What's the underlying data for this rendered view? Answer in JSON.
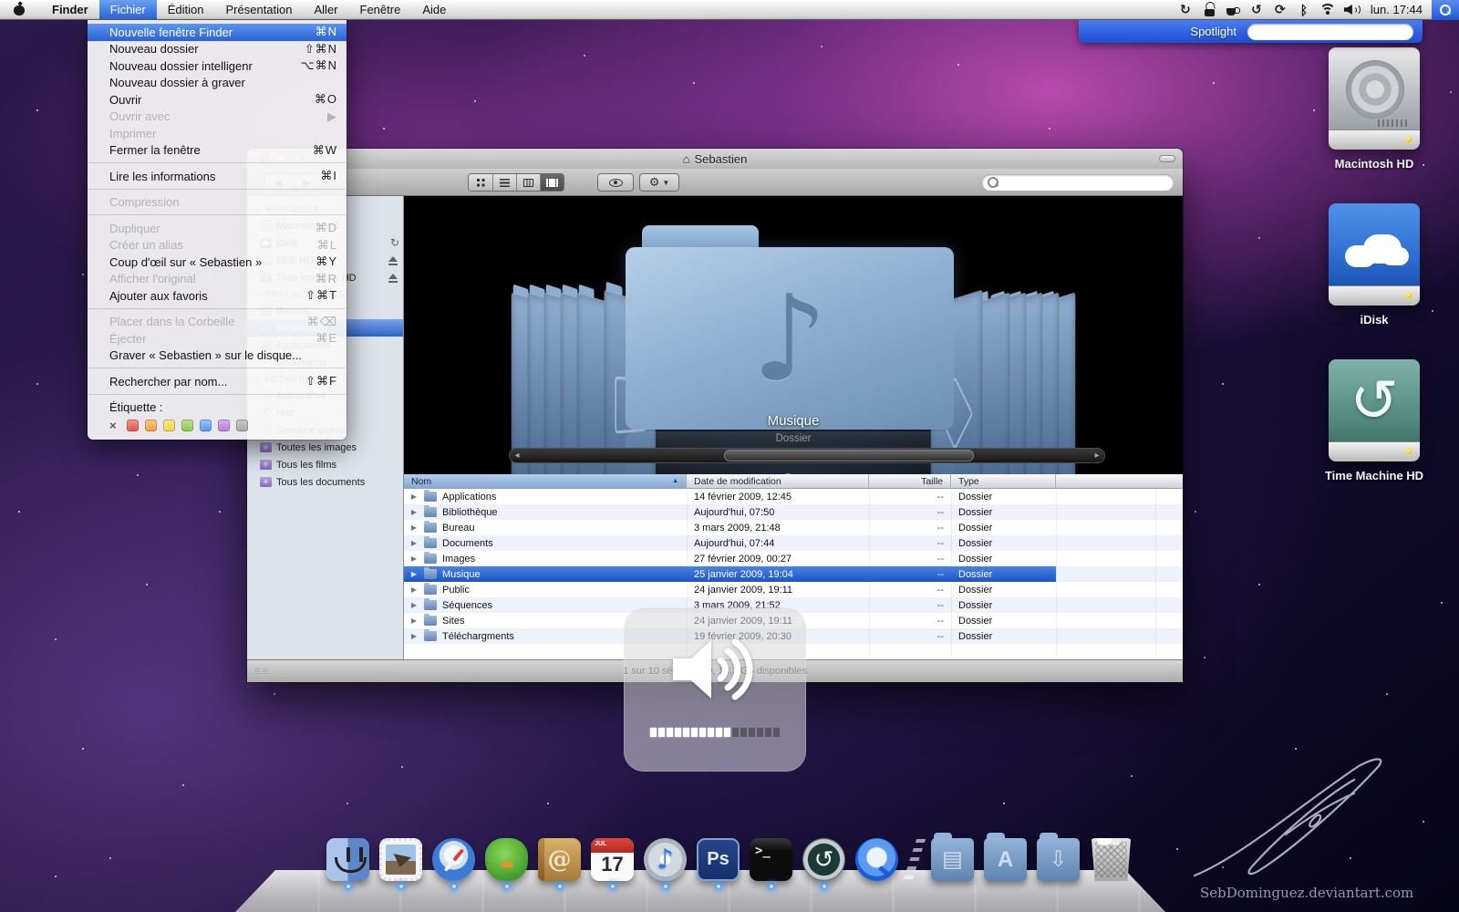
{
  "menu_bar": {
    "menus": [
      {
        "label": "Finder",
        "bold": true
      },
      {
        "label": "Fichier",
        "active": true
      },
      {
        "label": "Édition"
      },
      {
        "label": "Présentation"
      },
      {
        "label": "Aller"
      },
      {
        "label": "Fenêtre"
      },
      {
        "label": "Aide"
      }
    ],
    "status_icons": [
      "user-switch-icon",
      "lock-open-icon",
      "coffee-icon",
      "time-machine-icon",
      "sync-icon",
      "bluetooth-icon",
      "wifi-icon",
      "volume-icon"
    ],
    "clock": "lun. 17:44"
  },
  "spotlight": {
    "label": "Spotlight",
    "query": "",
    "placeholder": ""
  },
  "file_menu": {
    "items": [
      {
        "label": "Nouvelle fenêtre Finder",
        "shortcut": "⌘N",
        "highlighted": true
      },
      {
        "label": "Nouveau dossier",
        "shortcut": "⇧⌘N"
      },
      {
        "label": "Nouveau dossier intelligenr",
        "shortcut": "⌥⌘N"
      },
      {
        "label": "Nouveau dossier à graver",
        "shortcut": ""
      },
      {
        "label": "Ouvrir",
        "shortcut": "⌘O"
      },
      {
        "label": "Ouvrir avec",
        "shortcut": "▶",
        "disabled": true
      },
      {
        "label": "Imprimer",
        "shortcut": "",
        "disabled": true
      },
      {
        "label": "Fermer la fenêtre",
        "shortcut": "⌘W"
      },
      {
        "type": "separator"
      },
      {
        "label": "Lire les informations",
        "shortcut": "⌘I"
      },
      {
        "type": "separator"
      },
      {
        "label": "Compression",
        "shortcut": "",
        "disabled": true
      },
      {
        "type": "separator"
      },
      {
        "label": "Dupliquer",
        "shortcut": "⌘D",
        "disabled": true
      },
      {
        "label": "Créer un alias",
        "shortcut": "⌘L",
        "disabled": true
      },
      {
        "label": "Coup d'œil sur « Sebastien »",
        "shortcut": "⌘Y"
      },
      {
        "label": "Afficher l'original",
        "shortcut": "⌘R",
        "disabled": true
      },
      {
        "label": "Ajouter aux favoris",
        "shortcut": "⇧⌘T"
      },
      {
        "type": "separator"
      },
      {
        "label": "Placer dans la Corbeille",
        "shortcut": "⌘⌫",
        "disabled": true
      },
      {
        "label": "Éjecter",
        "shortcut": "⌘E",
        "disabled": true
      },
      {
        "label": "Graver « Sebastien » sur le disque...",
        "shortcut": ""
      },
      {
        "type": "separator"
      },
      {
        "label": "Rechercher par nom...",
        "shortcut": "⇧⌘F"
      },
      {
        "type": "separator"
      },
      {
        "label": "Étiquette :",
        "shortcut": ""
      }
    ],
    "label_none": "×",
    "label_colors": [
      "#e8564a",
      "#f5a43a",
      "#f5d943",
      "#8ed04e",
      "#5b9bf4",
      "#c07ee2",
      "#a9a9a9"
    ]
  },
  "finder_window": {
    "title": "Sebastien",
    "title_icon": "⌂",
    "toolbar_icons": [
      "back-icon",
      "forward-icon",
      "icon-view-icon",
      "list-view-icon",
      "column-view-icon",
      "coverflow-view-icon",
      "quicklook-eye-icon",
      "action-gear-icon",
      "search-icon"
    ],
    "search": {
      "value": "",
      "placeholder": ""
    },
    "sidebar": {
      "items": [
        {
          "type": "header",
          "label": "APPAREILS"
        },
        {
          "label": "Macintosh HD",
          "icon": "icon-drive"
        },
        {
          "label": "iDisk",
          "icon": "icon-idisk",
          "accessory": "acc-sync"
        },
        {
          "label": "SEB HD",
          "icon": "icon-drive",
          "accessory": "acc-eject"
        },
        {
          "label": "Time machine HD",
          "icon": "icon-tmdrive",
          "accessory": "acc-eject"
        },
        {
          "type": "header",
          "label": "EMPLACEMENTS"
        },
        {
          "label": "Bureau",
          "icon": "icon-desktop"
        },
        {
          "label": "Sebastien",
          "icon": "icon-home",
          "selected": true
        },
        {
          "label": "Applications",
          "icon": "icon-appA"
        },
        {
          "label": "Documents",
          "icon": "icon-docpage"
        },
        {
          "type": "header",
          "label": "RECHERCHER"
        },
        {
          "label": "Aujourd'hui",
          "icon": "icon-clock"
        },
        {
          "label": "Hier",
          "icon": "icon-clock"
        },
        {
          "label": "Semaine passé",
          "icon": "icon-clock"
        },
        {
          "label": "Toutes les images",
          "icon": "icon-smart"
        },
        {
          "label": "Tous les films",
          "icon": "icon-smart"
        },
        {
          "label": "Tous les documents",
          "icon": "icon-smart"
        }
      ]
    },
    "coverflow": {
      "selected_title": "Musique",
      "selected_subtitle": "Dossier",
      "left_arrow": "◂",
      "right_arrow": "▸",
      "grip": "≡",
      "note_glyph": "♪"
    },
    "list": {
      "columns": {
        "name": "Nom",
        "date": "Date de modification",
        "size": "Taille",
        "type": "Type",
        "sort_arrow": "▲"
      },
      "rows": [
        {
          "name": "Applications",
          "date": "14 février 2009, 12:45",
          "size": "--",
          "ftype": "Dossier"
        },
        {
          "name": "Bibliothèque",
          "date": "Aujourd'hui, 07:50",
          "size": "--",
          "ftype": "Dossier"
        },
        {
          "name": "Bureau",
          "date": "3 mars 2009, 21:48",
          "size": "--",
          "ftype": "Dossier"
        },
        {
          "name": "Documents",
          "date": "Aujourd'hui, 07:44",
          "size": "--",
          "ftype": "Dossier"
        },
        {
          "name": "Images",
          "date": "27 février 2009, 00:27",
          "size": "--",
          "ftype": "Dossier"
        },
        {
          "name": "Musique",
          "date": "25 janvier 2009, 19:04",
          "size": "--",
          "ftype": "Dossier",
          "selected": true
        },
        {
          "name": "Public",
          "date": "24 janvier 2009, 19:11",
          "size": "--",
          "ftype": "Dossier"
        },
        {
          "name": "Séquences",
          "date": "3 mars 2009, 21:52",
          "size": "--",
          "ftype": "Dossier"
        },
        {
          "name": "Sites",
          "date": "24 janvier 2009, 19:11",
          "size": "--",
          "ftype": "Dossier"
        },
        {
          "name": "Téléchargments",
          "date": "19 février 2009, 20:30",
          "size": "--",
          "ftype": "Dossier"
        }
      ]
    },
    "status_bar": "1 sur 10 sélectionné, 13,3 Go disponibles"
  },
  "desktop_icons": [
    {
      "label": "Macintosh HD",
      "icon": "drive-machd"
    },
    {
      "label": "iDisk",
      "icon": "drive-idisk"
    },
    {
      "label": "Time Machine HD",
      "icon": "drive-tm"
    }
  ],
  "volume_osd": {
    "icon": "speaker-icon",
    "level_on": 10,
    "level_total": 16,
    "segments": [
      1,
      1,
      1,
      1,
      1,
      1,
      1,
      1,
      1,
      1,
      0,
      0,
      0,
      0,
      0,
      0
    ]
  },
  "dock": {
    "items": [
      {
        "name": "Finder",
        "icon": "ic-finder",
        "running": true
      },
      {
        "name": "Mail",
        "icon": "ic-mail",
        "running": true
      },
      {
        "name": "Safari",
        "icon": "ic-safari",
        "running": true
      },
      {
        "name": "Adium",
        "icon": "ic-adium",
        "running": true
      },
      {
        "name": "Carnet d'adresses",
        "icon": "ic-contacts",
        "running": true
      },
      {
        "name": "iCal",
        "icon": "ic-ical",
        "running": true
      },
      {
        "name": "iTunes",
        "icon": "ic-itunes",
        "running": true
      },
      {
        "name": "Photoshop",
        "icon": "ic-ps",
        "running": true
      },
      {
        "name": "Terminal",
        "icon": "ic-terminal",
        "running": true
      },
      {
        "name": "Time Machine",
        "icon": "ic-tm",
        "running": true
      },
      {
        "name": "QuickTime",
        "icon": "ic-qt"
      },
      {
        "type": "separator"
      },
      {
        "name": "Documents",
        "icon": "ic-folder ic-folder-docs"
      },
      {
        "name": "Applications",
        "icon": "ic-folder ic-folder-apps"
      },
      {
        "name": "Téléchargements",
        "icon": "ic-folder ic-folder-dl"
      },
      {
        "name": "Corbeille",
        "icon": "ic-trash"
      }
    ]
  },
  "signature": "SebDominguez.deviantart.com"
}
